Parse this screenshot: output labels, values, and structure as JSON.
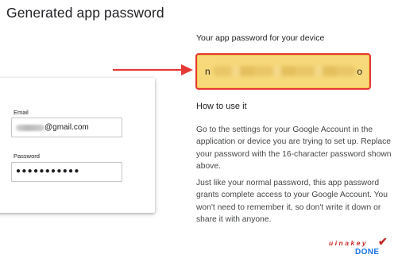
{
  "dialog": {
    "title": "Generated app password"
  },
  "login_card": {
    "email_label": "Email",
    "email_value": "@gmail.com",
    "password_label": "Password",
    "password_value": "●●●●●●●●●●●"
  },
  "password_panel": {
    "heading": "Your app password for your device",
    "first_char": "n",
    "last_char": "o"
  },
  "howto": {
    "title": "How to use it",
    "paragraph1": "Go to the settings for your Google Account in the application or device you are trying to set up. Replace your password with the 16-character password shown above.",
    "paragraph2": "Just like your normal password, this app password grants complete access to your Google Account. You won't need to remember it, so don't write it down or share it with anyone."
  },
  "actions": {
    "done_label": "DONE"
  },
  "watermark": {
    "text": "uinakey"
  },
  "colors": {
    "highlight": "#f7d97a",
    "highlight_border": "#e53935",
    "arrow": "#e53935",
    "accent": "#1a73e8"
  }
}
